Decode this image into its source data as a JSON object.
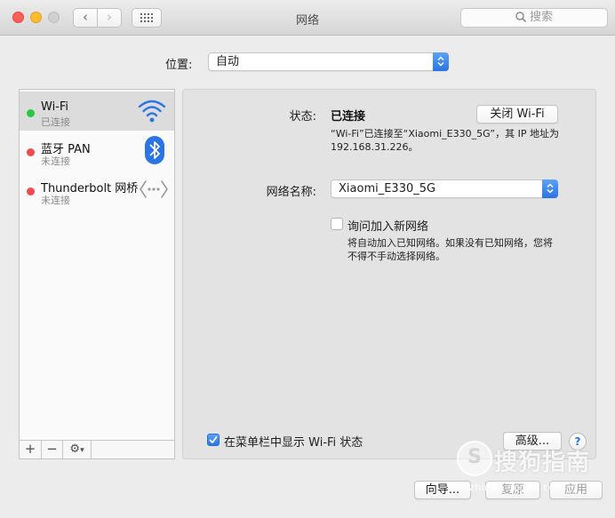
{
  "window": {
    "title": "网络",
    "search_placeholder": "搜索"
  },
  "location": {
    "label": "位置:",
    "value": "自动"
  },
  "sidebar": {
    "services": [
      {
        "name": "Wi-Fi",
        "status": "已连接",
        "dot_color": "#28c840",
        "icon": "wifi-icon",
        "selected": true
      },
      {
        "name": "蓝牙 PAN",
        "status": "未连接",
        "dot_color": "#f04b4b",
        "icon": "bluetooth-icon",
        "selected": false
      },
      {
        "name": "Thunderbolt 网桥",
        "status": "未连接",
        "dot_color": "#f04b4b",
        "icon": "thunderbolt-bridge-icon",
        "selected": false
      }
    ],
    "tools": {
      "add": "+",
      "remove": "−"
    }
  },
  "detail": {
    "status_label": "状态:",
    "status_value": "已连接",
    "wifi_off_button": "关闭 Wi-Fi",
    "status_description": "“Wi-Fi”已连接至“Xiaomi_E330_5G”，其 IP 地址为 192.168.31.226。",
    "network_name_label": "网络名称:",
    "network_name_value": "Xiaomi_E330_5G",
    "ask_join_label": "询问加入新网络",
    "ask_join_checked": false,
    "ask_join_description": "将自动加入已知网络。如果没有已知网络，您将不得不手动选择网络。",
    "show_in_menubar_label": "在菜单栏中显示 Wi-Fi 状态",
    "show_in_menubar_checked": true,
    "advanced_button": "高级...",
    "help_button": "?"
  },
  "footer": {
    "assist_button": "向导...",
    "revert_button": "复原",
    "apply_button": "应用"
  },
  "watermark": {
    "logo": "S",
    "text": "搜狗指南",
    "url": "zhinan.sogou.com"
  },
  "colors": {
    "accent": "#2a74e6",
    "connected": "#28c840",
    "disconnected": "#f04b4b"
  }
}
